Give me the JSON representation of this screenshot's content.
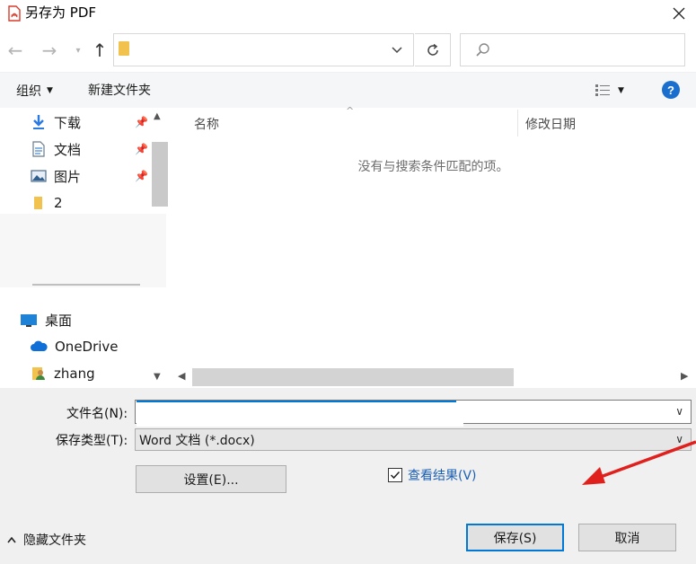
{
  "window": {
    "title": "另存为 PDF"
  },
  "nav_pane": {
    "items": [
      {
        "label": "下载",
        "icon": "download-arrow-icon",
        "pinned": true
      },
      {
        "label": "文档",
        "icon": "document-icon",
        "pinned": true
      },
      {
        "label": "图片",
        "icon": "picture-icon",
        "pinned": true
      },
      {
        "label": "2",
        "icon": "folder-icon",
        "pinned": false
      },
      {
        "label": "桌面",
        "icon": "desktop-icon",
        "pinned": false
      },
      {
        "label": "OneDrive",
        "icon": "cloud-icon",
        "pinned": false
      },
      {
        "label": "zhang",
        "icon": "user-folder-icon",
        "pinned": false
      }
    ]
  },
  "toolbar": {
    "organize_label": "组织",
    "new_folder_label": "新建文件夹"
  },
  "file_list": {
    "columns": [
      "名称",
      "修改日期"
    ],
    "empty_message": "没有与搜索条件匹配的项。"
  },
  "form": {
    "filename_label": "文件名(N):",
    "filename_value": "",
    "filetype_label": "保存类型(T):",
    "filetype_value": "Word 文档 (*.docx)",
    "settings_label": "设置(E)...",
    "view_result_label": "查看结果(V)",
    "view_result_checked": true
  },
  "footer": {
    "hide_folders_label": "隐藏文件夹",
    "save_label": "保存(S)",
    "cancel_label": "取消"
  },
  "colors": {
    "accent": "#0078d7",
    "link": "#1a5fb4",
    "help": "#1a6fce",
    "annotation_arrow": "#e0201c",
    "folder": "#f1c24d"
  }
}
